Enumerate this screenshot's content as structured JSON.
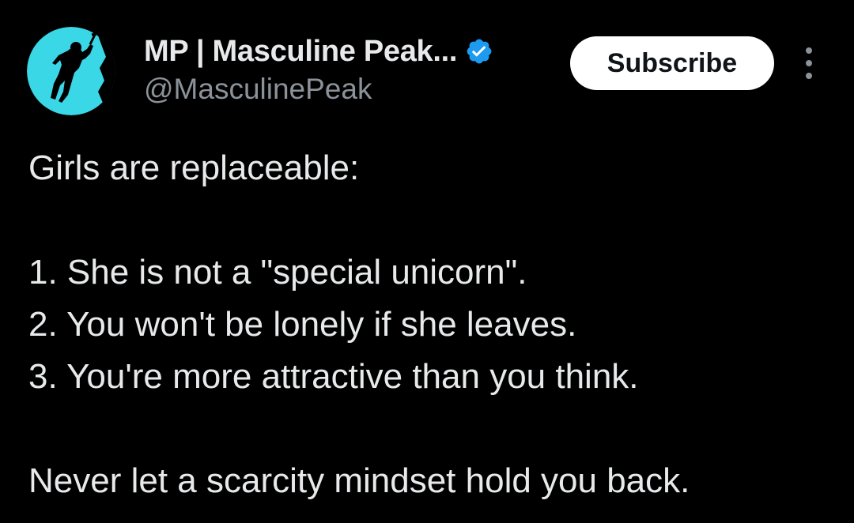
{
  "post": {
    "author": {
      "display_name": "MP | Masculine Peak...",
      "handle": "@MasculinePeak",
      "verified": true,
      "avatar_icon": "climber-silhouette-icon",
      "avatar_color": "#3ad7e6"
    },
    "subscribe_label": "Subscribe",
    "more_icon": "more-vertical-icon",
    "text_lines": {
      "l1": "Girls are replaceable:",
      "l2": "1. She is not a \"special unicorn\".",
      "l3": "2. You won't be lonely if she leaves.",
      "l4": "3. You're more attractive than you think.",
      "l5": "Never let a scarcity mindset hold you back."
    }
  },
  "colors": {
    "background": "#000000",
    "text_primary": "#e7e9ea",
    "text_secondary": "#8b9299",
    "verified_blue": "#1d9bf0",
    "button_bg": "#ffffff"
  }
}
